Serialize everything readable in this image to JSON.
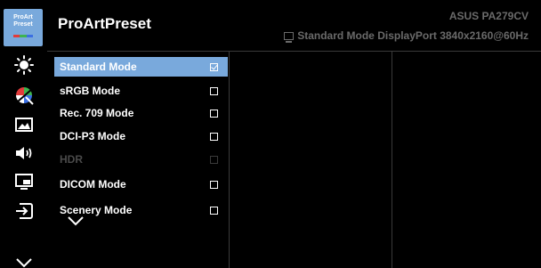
{
  "logo": {
    "line1": "ProArt",
    "line2": "Preset",
    "stripe_colors": [
      "#e23b3b",
      "#3fb34f",
      "#3b6fe2"
    ]
  },
  "header": {
    "title": "ProArtPreset",
    "model": "ASUS PA279CV",
    "status": "Standard Mode DisplayPort 3840x2160@60Hz"
  },
  "sidebar": {
    "icons": [
      {
        "name": "brightness-icon"
      },
      {
        "name": "color-icon"
      },
      {
        "name": "image-icon"
      },
      {
        "name": "sound-icon"
      },
      {
        "name": "pip-pbp-icon"
      },
      {
        "name": "input-select-icon"
      },
      {
        "name": "more-down-icon"
      }
    ]
  },
  "menu": {
    "items": [
      {
        "label": "Standard Mode",
        "checked": true,
        "selected": true,
        "disabled": false
      },
      {
        "label": "sRGB Mode",
        "checked": false,
        "selected": false,
        "disabled": false
      },
      {
        "label": "Rec. 709 Mode",
        "checked": false,
        "selected": false,
        "disabled": false
      },
      {
        "label": "DCI-P3 Mode",
        "checked": false,
        "selected": false,
        "disabled": false
      },
      {
        "label": "HDR",
        "checked": false,
        "selected": false,
        "disabled": true
      },
      {
        "label": "DICOM Mode",
        "checked": false,
        "selected": false,
        "disabled": false
      },
      {
        "label": "Scenery Mode",
        "checked": false,
        "selected": false,
        "disabled": false
      }
    ]
  },
  "colors": {
    "accent": "#79a9dc",
    "background": "#000000",
    "muted_text": "#6a6a6a",
    "disabled_text": "#4a4a4a"
  }
}
